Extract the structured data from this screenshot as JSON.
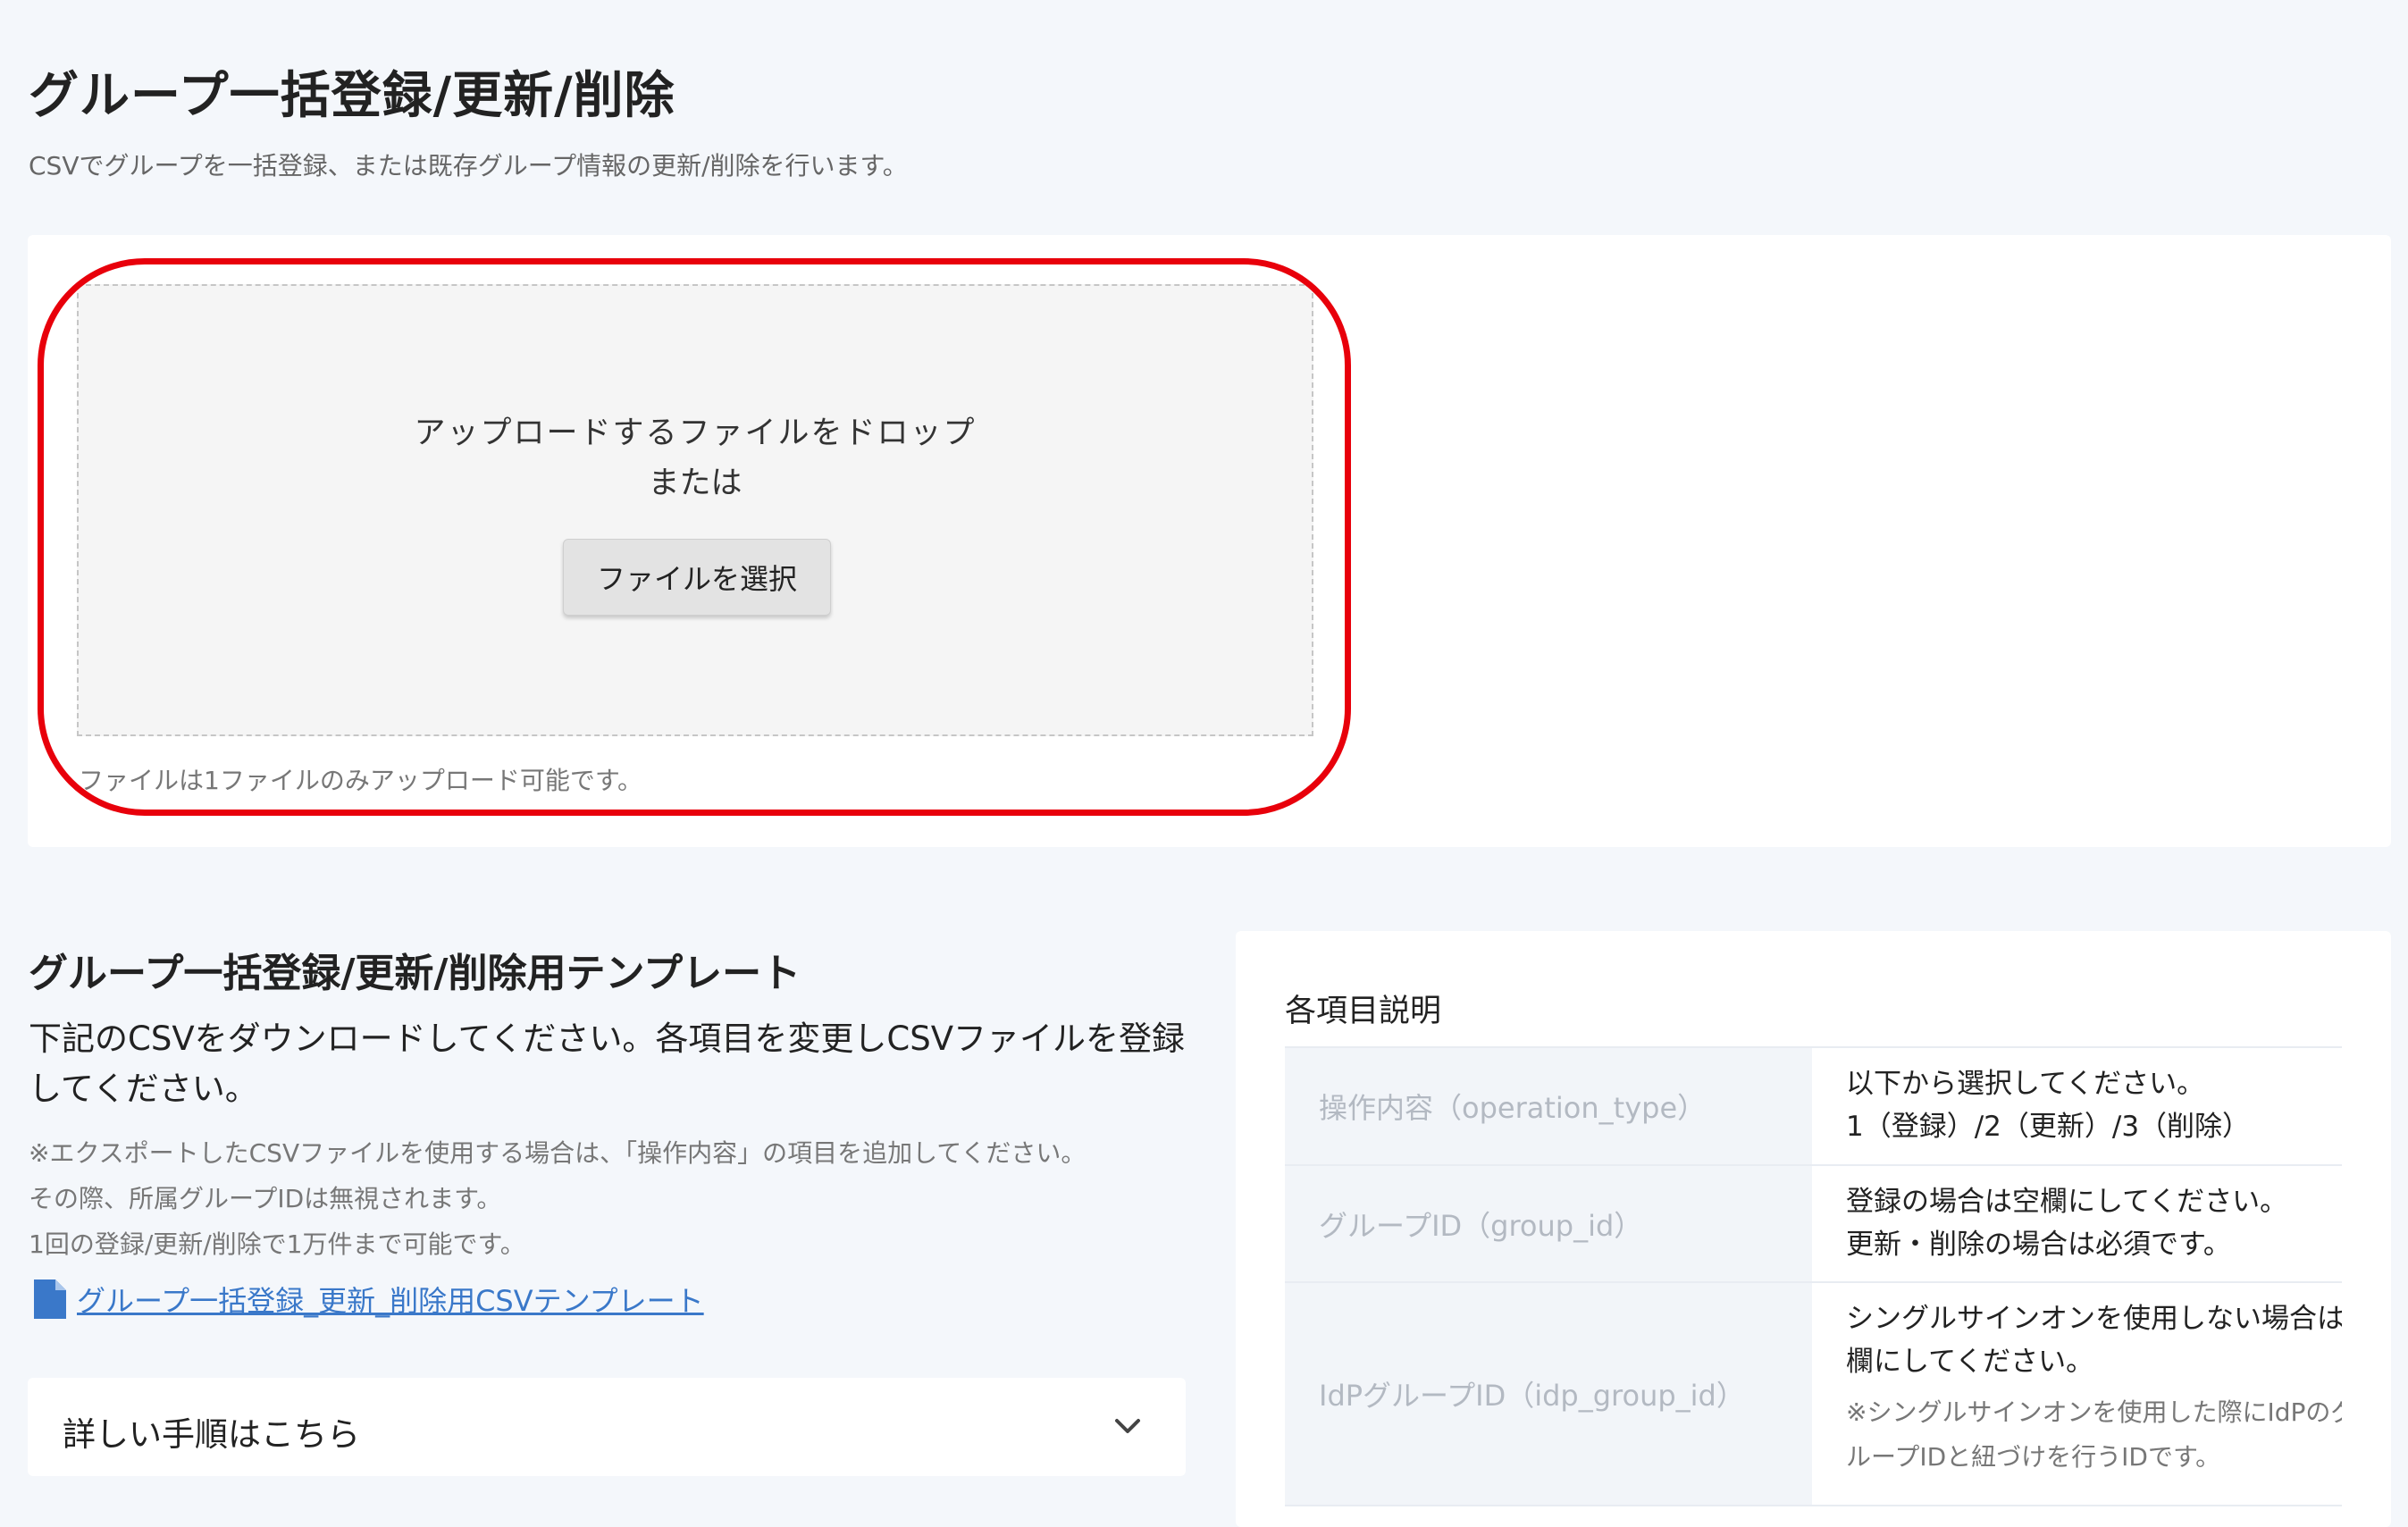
{
  "header": {
    "title": "グループ一括登録/更新/削除",
    "subtitle": "CSVでグループを一括登録、または既存グループ情報の更新/削除を行います。"
  },
  "upload": {
    "drop_text": "アップロードするファイルをドロップ",
    "or_text": "または",
    "select_button": "ファイルを選択",
    "note": "ファイルは1ファイルのみアップロード可能です。"
  },
  "template": {
    "title": "グループ一括登録/更新/削除用テンプレート",
    "description": "下記のCSVをダウンロードしてください。各項目を変更しCSVファイルを登録してください。",
    "notes": [
      "※エクスポートしたCSVファイルを使用する場合は、「操作内容」の項目を追加してください。",
      "その際、所属グループIDは無視されます。",
      "1回の登録/更新/削除で1万件まで可能です。"
    ],
    "link_text": "グループ一括登録_更新_削除用CSVテンプレート",
    "accordion_label": "詳しい手順はこちら"
  },
  "descriptions": {
    "title": "各項目説明",
    "rows": [
      {
        "key": "操作内容（operation_type）",
        "lines": [
          "以下から選択してください。",
          "1（登録）/2（更新）/3（削除）"
        ],
        "sub": []
      },
      {
        "key": "グループID（group_id）",
        "lines": [
          "登録の場合は空欄にしてください。",
          "更新・削除の場合は必須です。"
        ],
        "sub": []
      },
      {
        "key": "IdPグループID（idp_group_id）",
        "lines": [
          "シングルサインオンを使用しない場合は空",
          "欄にしてください。"
        ],
        "sub": [
          "※シングルサインオンを使用した際にIdPのグ",
          "ループIDと紐づけを行うIDです。"
        ]
      }
    ]
  },
  "colors": {
    "highlight": "#e8000b",
    "link": "#3a78c9",
    "background": "#f4f7fb"
  }
}
